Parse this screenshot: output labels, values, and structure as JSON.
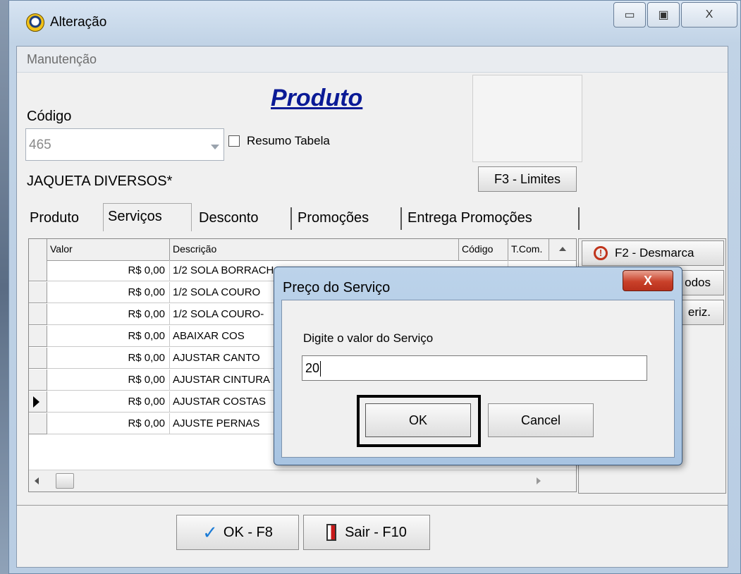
{
  "window": {
    "title": "Alteração",
    "minimize_glyph": "▭",
    "maximize_glyph": "▣",
    "close_glyph": "X"
  },
  "menu": {
    "items": [
      "Manutenção"
    ]
  },
  "form": {
    "title": "Produto",
    "codigo_label": "Código",
    "codigo_value": "465",
    "resumo_tabela_label": "Resumo Tabela",
    "resumo_tabela_checked": false,
    "limites_button": "F3 - Limites",
    "product_name": "JAQUETA DIVERSOS*"
  },
  "tabs": [
    {
      "label": "Produto",
      "active": false
    },
    {
      "label": "Serviços",
      "active": true
    },
    {
      "label": "Desconto",
      "active": false
    },
    {
      "label": "Promoções",
      "active": false
    },
    {
      "label": "Entrega Promoções",
      "active": false
    }
  ],
  "grid": {
    "columns": [
      "Valor",
      "Descrição",
      "Código",
      "T.Com."
    ],
    "rows": [
      {
        "valor": "R$ 0,00",
        "descricao": "1/2 SOLA BORRACHA",
        "selected": false
      },
      {
        "valor": "R$ 0,00",
        "descricao": "1/2 SOLA COURO",
        "selected": false
      },
      {
        "valor": "R$ 0,00",
        "descricao": "1/2 SOLA COURO-",
        "selected": false
      },
      {
        "valor": "R$ 0,00",
        "descricao": "ABAIXAR COS",
        "selected": false
      },
      {
        "valor": "R$ 0,00",
        "descricao": "AJUSTAR CANTO",
        "selected": false
      },
      {
        "valor": "R$ 0,00",
        "descricao": "AJUSTAR CINTURA",
        "selected": false
      },
      {
        "valor": "R$ 0,00",
        "descricao": "AJUSTAR COSTAS",
        "selected": true
      },
      {
        "valor": "R$ 0,00",
        "descricao": "AJUSTE  PERNAS",
        "selected": false
      }
    ]
  },
  "side_buttons": [
    {
      "label": "F2 - Desmarca",
      "icon": "alert-icon"
    },
    {
      "label": "odos"
    },
    {
      "label": "eriz."
    }
  ],
  "footer": {
    "ok_label": "OK - F8",
    "exit_label": "Sair - F10"
  },
  "dialog": {
    "title": "Preço do Serviço",
    "prompt": "Digite o valor do Serviço",
    "input_value": "20",
    "ok_label": "OK",
    "cancel_label": "Cancel",
    "close_glyph": "X"
  },
  "colors": {
    "form_title": "#0a1a96",
    "dialog_close": "#c9412a",
    "checkmark": "#1b7bd6"
  }
}
